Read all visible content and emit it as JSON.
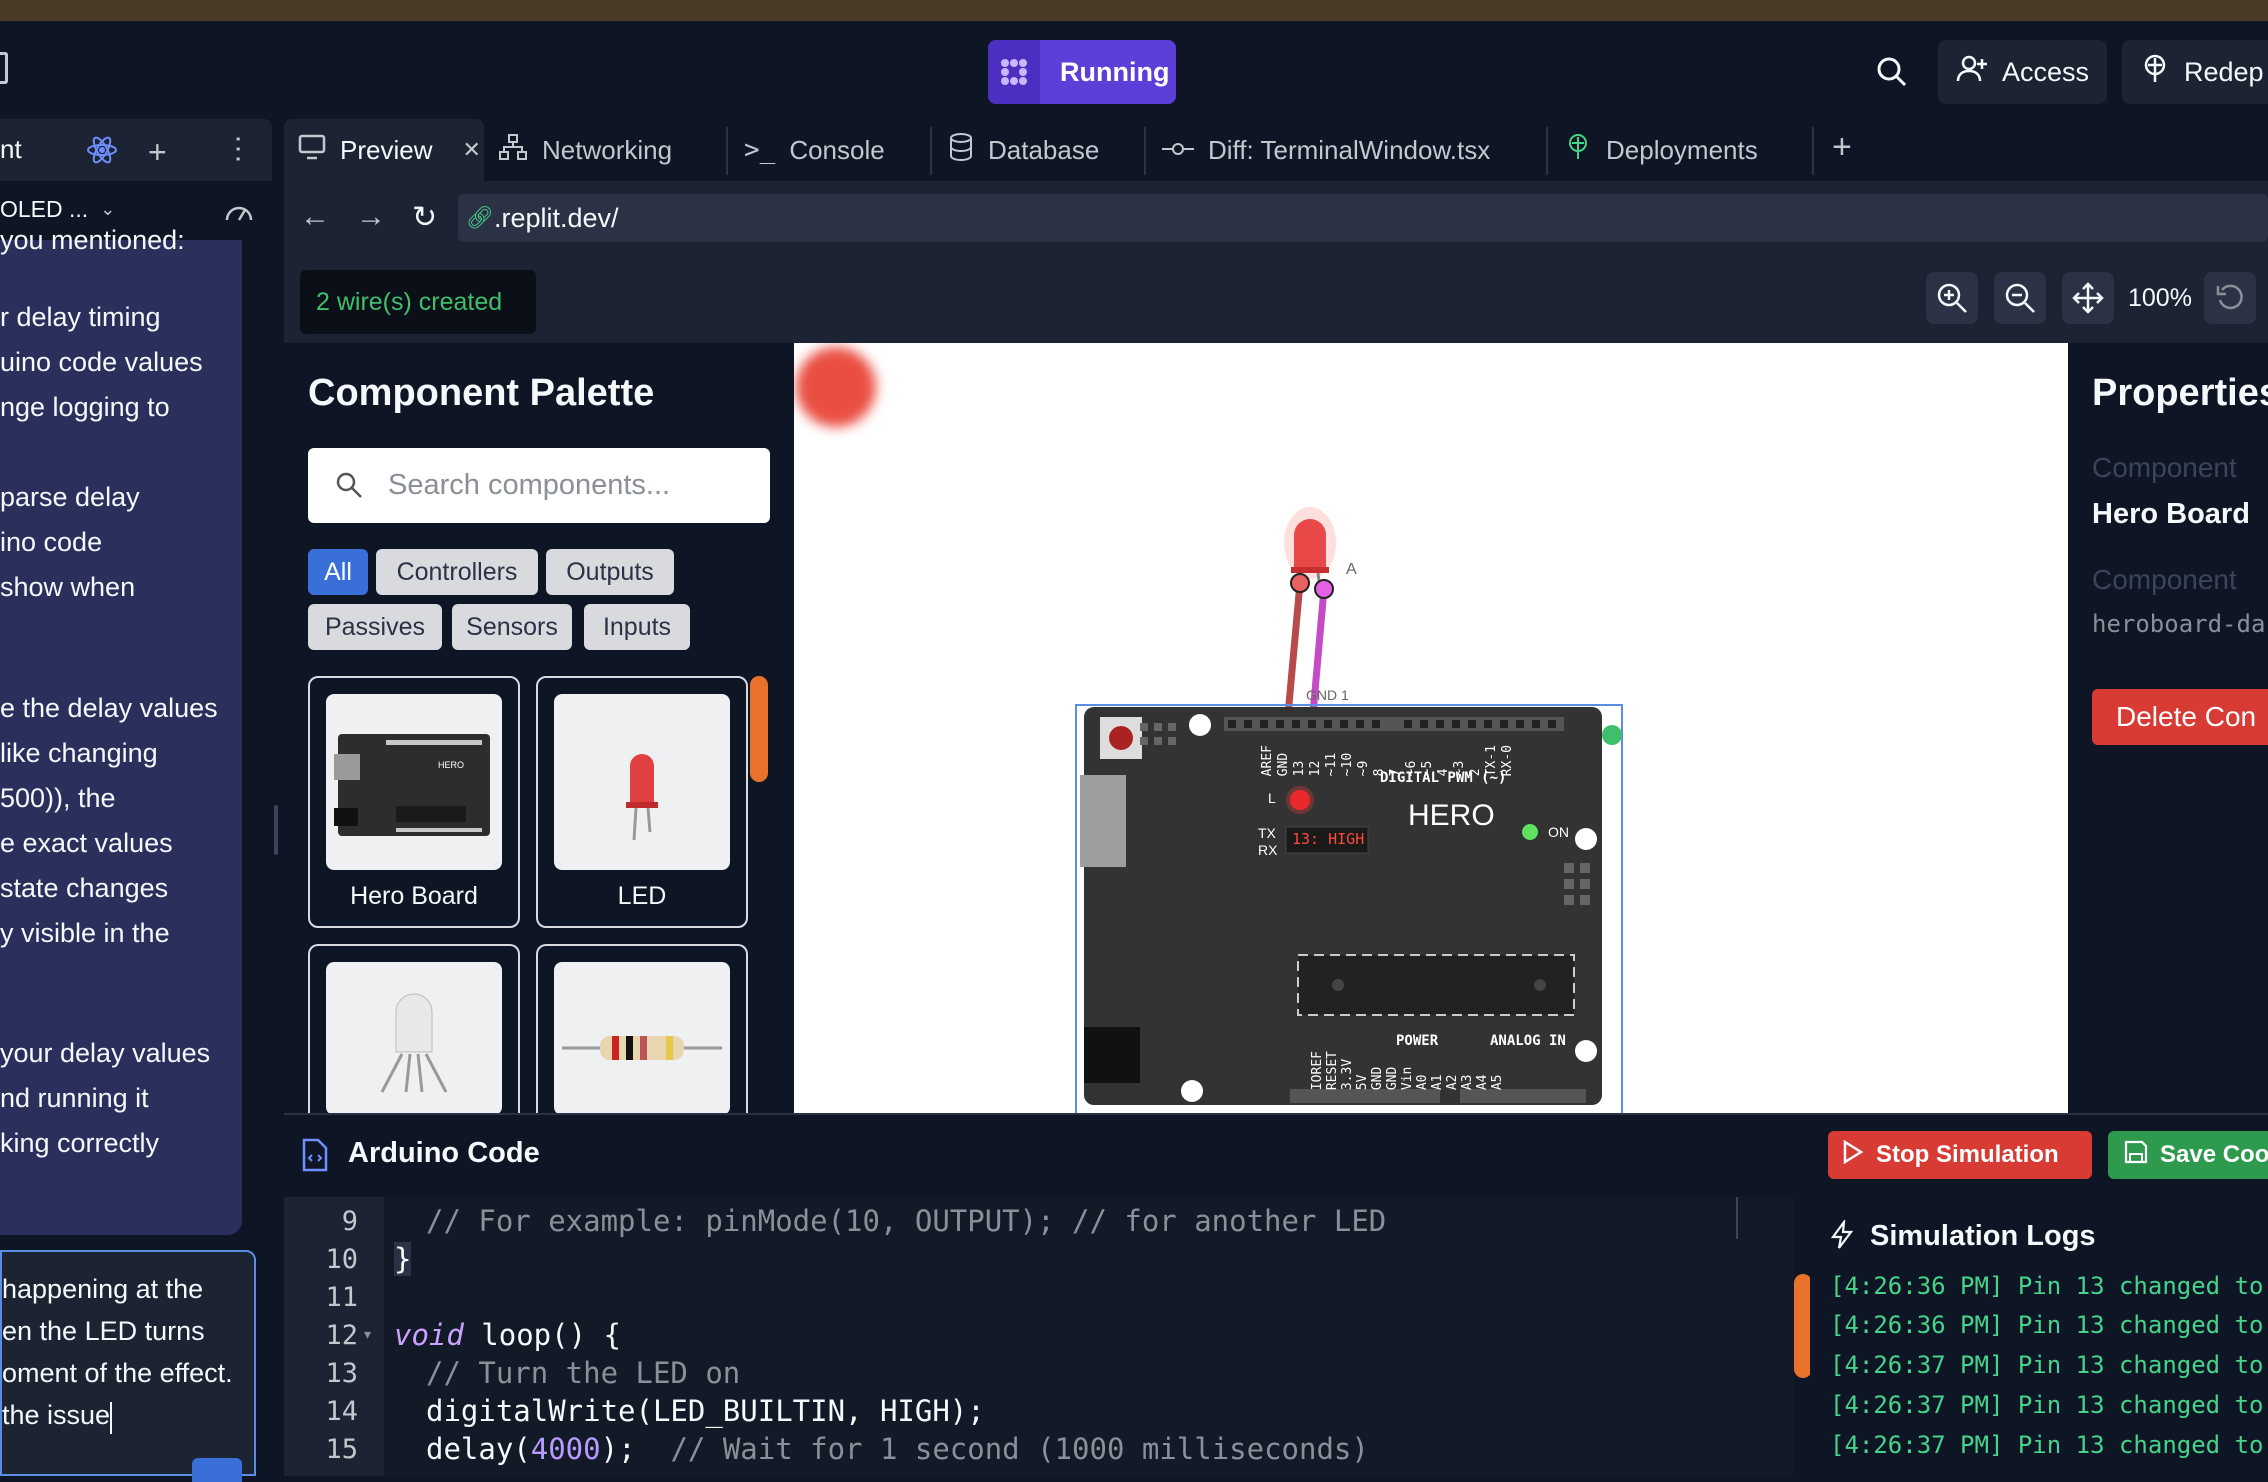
{
  "header": {
    "run_label": "Running",
    "access_label": "Access",
    "redeploy_label": "Redep"
  },
  "left_panel": {
    "tab_label": "nt",
    "project_label": "OLED ...",
    "chat_lines": [
      "you mentioned:",
      "r delay timing",
      "uino code values",
      "nge logging to",
      "parse delay",
      "ino code",
      "show when",
      "e the delay values",
      "like changing",
      "500)), the",
      "e exact values",
      "state changes",
      "y visible in the",
      "your delay values",
      "nd running it",
      "king correctly"
    ],
    "input_lines": [
      "happening at the",
      "en the LED turns",
      "oment of the effect.",
      "the issue"
    ]
  },
  "tabs": [
    {
      "label": "Preview",
      "icon": "monitor-icon"
    },
    {
      "label": "Networking",
      "icon": "network-icon"
    },
    {
      "label": "Console",
      "icon": "terminal-icon"
    },
    {
      "label": "Database",
      "icon": "database-icon"
    },
    {
      "label": "Diff: TerminalWindow.tsx",
      "icon": "git-commit-icon"
    },
    {
      "label": "Deployments",
      "icon": "deploy-icon"
    }
  ],
  "url": {
    "value": ".replit.dev/"
  },
  "toolbar": {
    "wire_message": "2 wire(s) created",
    "zoom_level": "100%"
  },
  "palette": {
    "title": "Component Palette",
    "search_placeholder": "Search components...",
    "filters": [
      "All",
      "Controllers",
      "Outputs",
      "Passives",
      "Sensors",
      "Inputs"
    ],
    "active_filter": "All",
    "components": [
      "Hero Board",
      "LED"
    ]
  },
  "board": {
    "name": "HERO",
    "digital_label": "DIGITAL PWM (~)",
    "analog_label": "ANALOG IN",
    "power_label": "POWER",
    "on_label": "ON",
    "l_label": "L",
    "tx_label": "TX",
    "rx_label": "RX",
    "pin_status": "13: HIGH",
    "gnd_label": "GND 1",
    "led_anode": "A",
    "top_pins": [
      "AREF",
      "GND",
      "13",
      "12",
      "~11",
      "~10",
      "~9",
      "8",
      "7",
      "~6",
      "~5",
      "4",
      "~3",
      "2",
      "TX-1",
      "RX-0"
    ],
    "bottom_pins": [
      "IOREF",
      "RESET",
      "3.3V",
      "5V",
      "GND",
      "GND",
      "Vin",
      "A0",
      "A1",
      "A2",
      "A3",
      "A4",
      "A5"
    ]
  },
  "properties": {
    "title": "Properties",
    "component_label_1": "Component",
    "component_name": "Hero Board",
    "component_label_2": "Component",
    "component_id": "heroboard-da",
    "delete_label": "Delete Con"
  },
  "code": {
    "title": "Arduino Code",
    "stop_label": "Stop Simulation",
    "save_label": "Save Coo",
    "lines": [
      {
        "n": "9"
      },
      {
        "n": "10"
      },
      {
        "n": "11"
      },
      {
        "n": "12"
      },
      {
        "n": "13"
      },
      {
        "n": "14"
      },
      {
        "n": "15"
      }
    ],
    "l9": "// For example: pinMode(10, OUTPUT); // for another LED",
    "l10": "}",
    "l12_kw": "void",
    "l12_rest": " loop() {",
    "l13": "// Turn the LED on",
    "l14": "digitalWrite(LED_BUILTIN, HIGH);",
    "l15_a": "delay(",
    "l15_num": "4000",
    "l15_b": ");  ",
    "l15_cm": "// Wait for 1 second (1000 milliseconds)"
  },
  "logs": {
    "title": "Simulation Logs",
    "entries": [
      "[4:26:36 PM] Pin 13 changed to",
      "[4:26:36 PM] Pin 13 changed to",
      "[4:26:37 PM] Pin 13 changed to",
      "[4:26:37 PM] Pin 13 changed to",
      "[4:26:37 PM] Pin 13 changed to"
    ]
  },
  "colors": {
    "accent": "#5b3fd8",
    "stop_red": "#d83a34",
    "save_green": "#2e9a4e",
    "filter_active": "#3a6fd8"
  }
}
